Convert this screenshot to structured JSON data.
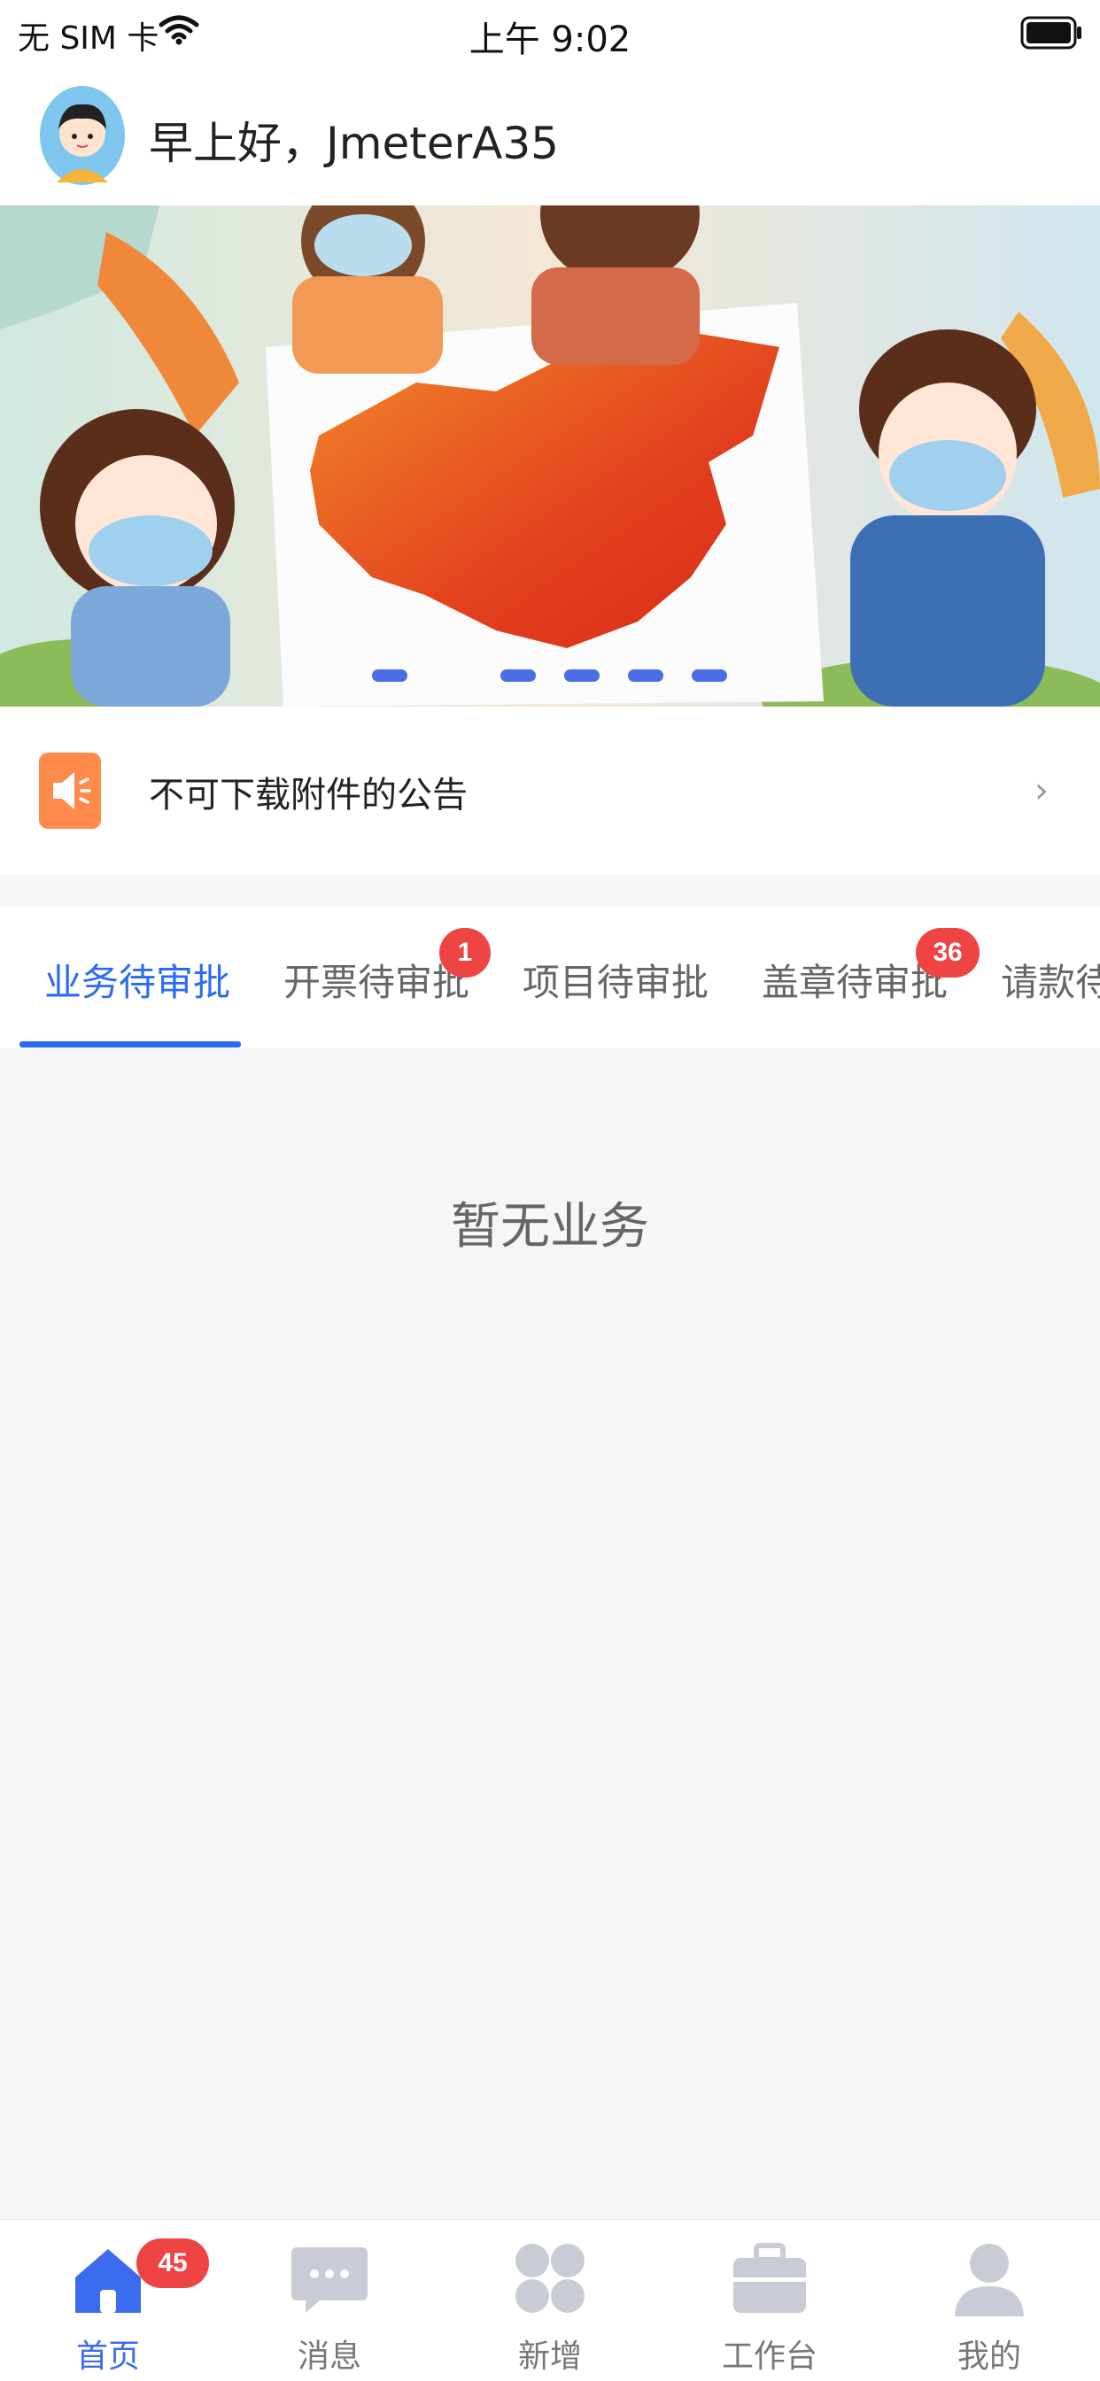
{
  "status_bar": {
    "carrier": "无 SIM 卡",
    "time": "上午 9:02"
  },
  "header": {
    "greeting": "早上好，JmeterA35",
    "avatar_icon": "avatar-icon"
  },
  "banner": {
    "pages": 5,
    "active_index": 0
  },
  "notice": {
    "icon": "speaker-icon",
    "text": "不可下载附件的公告",
    "chevron": "›"
  },
  "tabs": [
    {
      "label": "业务待审批",
      "active": true
    },
    {
      "label": "开票待审批",
      "badge": "1"
    },
    {
      "label": "项目待审批"
    },
    {
      "label": "盖章待审批",
      "badge": "36"
    },
    {
      "label": "请款待"
    }
  ],
  "empty_text": "暂无业务",
  "bottom_nav": [
    {
      "label": "首页",
      "icon": "home-icon",
      "active": true,
      "badge": "45"
    },
    {
      "label": "消息",
      "icon": "message-icon"
    },
    {
      "label": "新增",
      "icon": "add-grid-icon"
    },
    {
      "label": "工作台",
      "icon": "briefcase-icon"
    },
    {
      "label": "我的",
      "icon": "person-icon"
    }
  ],
  "colors": {
    "accent": "#2a6cf0",
    "badge": "#ef4444",
    "notice_icon": "#ff8a4c"
  }
}
